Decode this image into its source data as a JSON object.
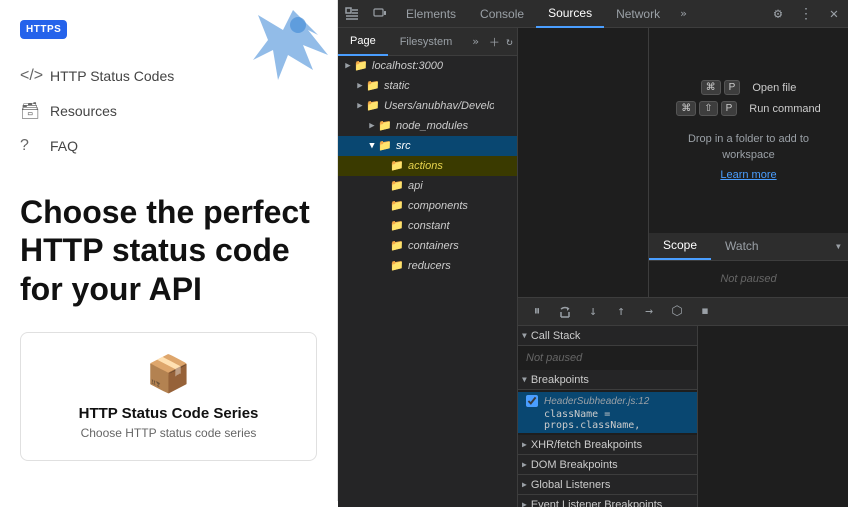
{
  "sidebar": {
    "logo": {
      "badge": "HTTPS",
      "title": "HTTP Status Codes"
    },
    "nav": [
      {
        "icon": "</>",
        "label": "HTTP Status Codes"
      },
      {
        "icon": "🗃",
        "label": "Resources"
      },
      {
        "icon": "?",
        "label": "FAQ"
      }
    ],
    "heading": "Choose the perfect HTTP status code for your API",
    "card": {
      "title": "HTTP Status Code Series",
      "subtitle": "Choose HTTP status code series"
    }
  },
  "devtools": {
    "tabs": [
      "Elements",
      "Console",
      "Sources",
      "Network"
    ],
    "active_tab": "Sources",
    "more_tabs": "»"
  },
  "file_tree": {
    "tabs": [
      "Page",
      "Filesystem"
    ],
    "active_tab": "Page",
    "items": [
      {
        "indent": 0,
        "arrow": "▶",
        "icon": "📁",
        "label": "localhost:3000",
        "type": "folder"
      },
      {
        "indent": 1,
        "arrow": "▶",
        "icon": "📁",
        "label": "static",
        "type": "folder"
      },
      {
        "indent": 1,
        "arrow": "▶",
        "icon": "📁",
        "label": "Users/anubhav/Developer/P",
        "type": "folder"
      },
      {
        "indent": 2,
        "arrow": "▶",
        "icon": "📁",
        "label": "node_modules",
        "type": "folder"
      },
      {
        "indent": 2,
        "arrow": "▼",
        "icon": "📁",
        "label": "src",
        "type": "folder",
        "selected": true
      },
      {
        "indent": 3,
        "arrow": " ",
        "icon": "📁",
        "label": "actions",
        "type": "folder",
        "highlighted": true
      },
      {
        "indent": 3,
        "arrow": " ",
        "icon": "📁",
        "label": "api",
        "type": "folder"
      },
      {
        "indent": 3,
        "arrow": " ",
        "icon": "📁",
        "label": "components",
        "type": "folder"
      },
      {
        "indent": 3,
        "arrow": " ",
        "icon": "📁",
        "label": "constant",
        "type": "folder"
      },
      {
        "indent": 3,
        "arrow": " ",
        "icon": "📁",
        "label": "containers",
        "type": "folder"
      },
      {
        "indent": 3,
        "arrow": " ",
        "icon": "📁",
        "label": "reducers",
        "type": "folder"
      }
    ]
  },
  "right_panel": {
    "shortcuts": [
      {
        "keys": [
          "⌘",
          "P"
        ],
        "label": "Open file"
      },
      {
        "keys": [
          "⌘",
          "⇧",
          "P"
        ],
        "label": "Run command"
      }
    ],
    "drop_text": "Drop in a folder to add to workspace",
    "learn_more": "Learn more",
    "tabs": [
      "Scope",
      "Watch"
    ],
    "active_tab": "Scope",
    "not_paused": "Not paused"
  },
  "bottom_panel": {
    "sections": {
      "call_stack": {
        "title": "Call Stack",
        "not_paused": "Not paused"
      },
      "breakpoints": {
        "title": "Breakpoints",
        "items": [
          {
            "file": "HeaderSubheader.js:12",
            "code": "className = props.className,"
          }
        ]
      },
      "xhr_fetch": {
        "title": "XHR/fetch Breakpoints"
      },
      "dom_breakpoints": {
        "title": "DOM Breakpoints"
      },
      "global_listeners": {
        "title": "Global Listeners"
      },
      "event_listeners": {
        "title": "Event Listener Breakpoints"
      }
    }
  }
}
